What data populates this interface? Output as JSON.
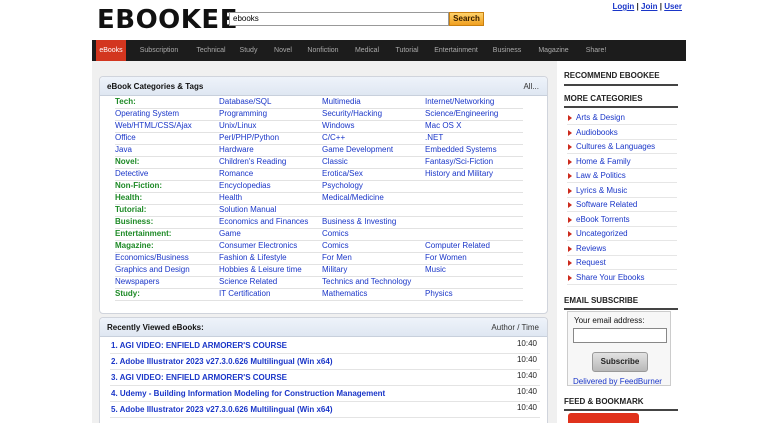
{
  "header": {
    "logo": "EBOOKEE",
    "search_value": "ebooks",
    "search_button": "Search",
    "login": "Login",
    "join": "Join",
    "user": "User",
    "separator": "|"
  },
  "nav": [
    "eBooks",
    "Subscription",
    "Technical",
    "Study",
    "Novel",
    "Nonfiction",
    "Medical",
    "Tutorial",
    "Entertainment",
    "Business",
    "Magazine",
    "Share!"
  ],
  "categories": {
    "title": "eBook Categories & Tags",
    "all_link": "All...",
    "rows": [
      [
        {
          "t": "Tech:",
          "c": 1
        },
        {
          "t": "Database/SQL"
        },
        {
          "t": "Multimedia"
        },
        {
          "t": "Internet/Networking"
        }
      ],
      [
        {
          "t": "Operating System"
        },
        {
          "t": "Programming"
        },
        {
          "t": "Security/Hacking"
        },
        {
          "t": "Science/Engineering"
        }
      ],
      [
        {
          "t": "Web/HTML/CSS/Ajax"
        },
        {
          "t": "Unix/Linux"
        },
        {
          "t": "Windows"
        },
        {
          "t": "Mac OS X"
        }
      ],
      [
        {
          "t": "Office"
        },
        {
          "t": "Perl/PHP/Python"
        },
        {
          "t": "C/C++"
        },
        {
          "t": ".NET"
        }
      ],
      [
        {
          "t": "Java"
        },
        {
          "t": "Hardware"
        },
        {
          "t": "Game Development"
        },
        {
          "t": "Embedded Systems"
        }
      ],
      [
        {
          "t": "Novel:",
          "c": 1
        },
        {
          "t": "Children's Reading"
        },
        {
          "t": "Classic"
        },
        {
          "t": "Fantasy/Sci-Fiction"
        }
      ],
      [
        {
          "t": "Detective"
        },
        {
          "t": "Romance"
        },
        {
          "t": "Erotica/Sex"
        },
        {
          "t": "History and Military"
        }
      ],
      [
        {
          "t": "Non-Fiction:",
          "c": 1
        },
        {
          "t": "Encyclopedias"
        },
        {
          "t": "Psychology"
        }
      ],
      [
        {
          "t": "Health:",
          "c": 1
        },
        {
          "t": "Health"
        },
        {
          "t": "Medical/Medicine"
        }
      ],
      [
        {
          "t": "Tutorial:",
          "c": 1
        },
        {
          "t": "Solution Manual"
        }
      ],
      [
        {
          "t": "Business:",
          "c": 1
        },
        {
          "t": "Economics and Finances"
        },
        {
          "t": "Business & Investing"
        }
      ],
      [
        {
          "t": "Entertainment:",
          "c": 1
        },
        {
          "t": "Game"
        },
        {
          "t": "Comics"
        }
      ],
      [
        {
          "t": "Magazine:",
          "c": 1
        },
        {
          "t": "Consumer Electronics"
        },
        {
          "t": "Comics"
        },
        {
          "t": "Computer Related"
        }
      ],
      [
        {
          "t": "Economics/Business"
        },
        {
          "t": "Fashion & Lifestyle"
        },
        {
          "t": "For Men"
        },
        {
          "t": "For Women"
        }
      ],
      [
        {
          "t": "Graphics and Design"
        },
        {
          "t": "Hobbies & Leisure time"
        },
        {
          "t": "Military"
        },
        {
          "t": "Music"
        }
      ],
      [
        {
          "t": "Newspapers"
        },
        {
          "t": "Science Related"
        },
        {
          "t": "Technics and Technology"
        }
      ],
      [
        {
          "t": "Study:",
          "c": 1
        },
        {
          "t": "IT Certification"
        },
        {
          "t": "Mathematics"
        },
        {
          "t": "Physics"
        }
      ]
    ]
  },
  "recent": {
    "title": "Recently Viewed eBooks:",
    "right": "Author / Time",
    "items": [
      {
        "label": "1. AGI VIDEO: ENFIELD ARMORER'S COURSE",
        "time": "10:40"
      },
      {
        "label": "2. Adobe Illustrator 2023 v27.3.0.626 Multilingual (Win x64)",
        "time": "10:40"
      },
      {
        "label": "3. AGI VIDEO: ENFIELD ARMORER'S COURSE",
        "time": "10:40"
      },
      {
        "label": "4. Udemy - Building Information Modeling for Construction Management",
        "time": "10:40"
      },
      {
        "label": "5. Adobe Illustrator 2023 v27.3.0.626 Multilingual (Win x64)",
        "time": "10:40"
      }
    ]
  },
  "sidebar": {
    "recommend": "RECOMMEND EBOOKEE",
    "more": "MORE CATEGORIES",
    "items": [
      "Arts & Design",
      "Audiobooks",
      "Cultures & Languages",
      "Home & Family",
      "Law & Politics",
      "Lyrics & Music",
      "Software Related",
      "eBook Torrents",
      "Uncategorized",
      "Reviews",
      "Request",
      "Share Your Ebooks"
    ],
    "email_head": "EMAIL SUBSCRIBE",
    "email_label": "Your email address:",
    "subscribe": "Subscribe",
    "delivered": "Delivered by FeedBurner",
    "feed_head": "FEED & BOOKMARK"
  }
}
